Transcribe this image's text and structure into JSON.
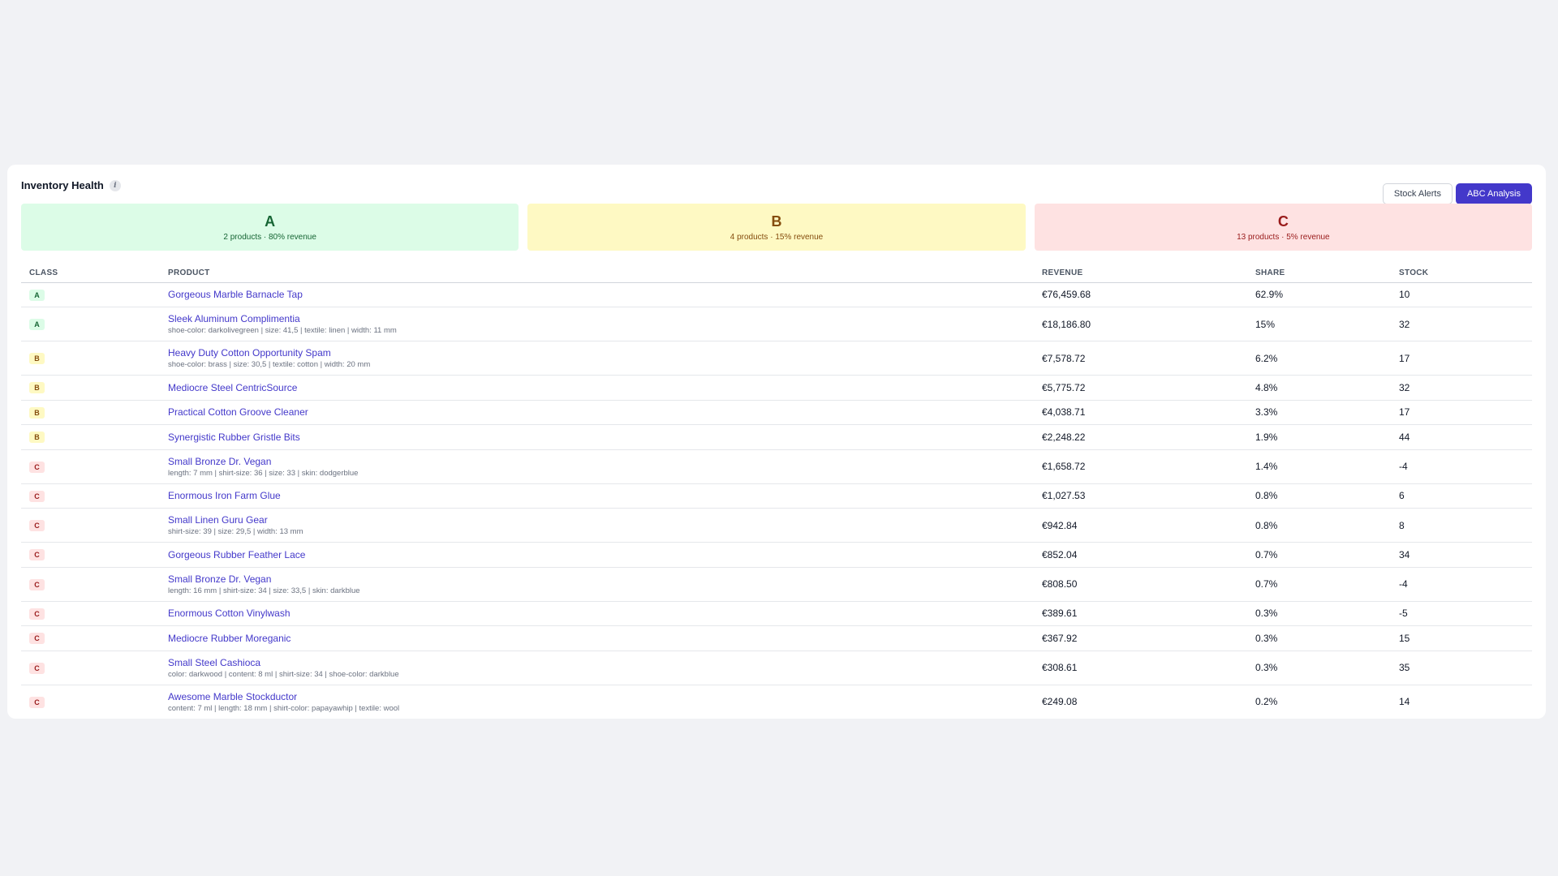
{
  "header": {
    "title": "Inventory Health",
    "info_icon": "info-icon"
  },
  "toggle": {
    "stock_alerts": "Stock Alerts",
    "abc_analysis": "ABC Analysis",
    "active": "ABC Analysis"
  },
  "summary": [
    {
      "letter": "A",
      "desc": "2 products · 80% revenue",
      "color": "#166534",
      "bg": "#dcfce7"
    },
    {
      "letter": "B",
      "desc": "4 products · 15% revenue",
      "color": "#854d0e",
      "bg": "#fef9c3"
    },
    {
      "letter": "C",
      "desc": "13 products · 5% revenue",
      "color": "#991b1b",
      "bg": "#fee2e2"
    }
  ],
  "table": {
    "columns": [
      "CLASS",
      "PRODUCT",
      "REVENUE",
      "SHARE",
      "STOCK"
    ],
    "rows": [
      {
        "class": "A",
        "product": "Gorgeous Marble Barnacle Tap",
        "attrs": "",
        "revenue": "€76,459.68",
        "share": "62.9%",
        "stock": "10"
      },
      {
        "class": "A",
        "product": "Sleek Aluminum Complimentia",
        "attrs": "shoe-color: darkolivegreen | size: 41,5 | textile: linen | width: 11 mm",
        "revenue": "€18,186.80",
        "share": "15%",
        "stock": "32"
      },
      {
        "class": "B",
        "product": "Heavy Duty Cotton Opportunity Spam",
        "attrs": "shoe-color: brass | size: 30,5 | textile: cotton | width: 20 mm",
        "revenue": "€7,578.72",
        "share": "6.2%",
        "stock": "17"
      },
      {
        "class": "B",
        "product": "Mediocre Steel CentricSource",
        "attrs": "",
        "revenue": "€5,775.72",
        "share": "4.8%",
        "stock": "32"
      },
      {
        "class": "B",
        "product": "Practical Cotton Groove Cleaner",
        "attrs": "",
        "revenue": "€4,038.71",
        "share": "3.3%",
        "stock": "17"
      },
      {
        "class": "B",
        "product": "Synergistic Rubber Gristle Bits",
        "attrs": "",
        "revenue": "€2,248.22",
        "share": "1.9%",
        "stock": "44"
      },
      {
        "class": "C",
        "product": "Small Bronze Dr. Vegan",
        "attrs": "length: 7 mm | shirt-size: 36 | size: 33 | skin: dodgerblue",
        "revenue": "€1,658.72",
        "share": "1.4%",
        "stock": "-4"
      },
      {
        "class": "C",
        "product": "Enormous Iron Farm Glue",
        "attrs": "",
        "revenue": "€1,027.53",
        "share": "0.8%",
        "stock": "6"
      },
      {
        "class": "C",
        "product": "Small Linen Guru Gear",
        "attrs": "shirt-size: 39 | size: 29,5 | width: 13 mm",
        "revenue": "€942.84",
        "share": "0.8%",
        "stock": "8"
      },
      {
        "class": "C",
        "product": "Gorgeous Rubber Feather Lace",
        "attrs": "",
        "revenue": "€852.04",
        "share": "0.7%",
        "stock": "34"
      },
      {
        "class": "C",
        "product": "Small Bronze Dr. Vegan",
        "attrs": "length: 16 mm | shirt-size: 34 | size: 33,5 | skin: darkblue",
        "revenue": "€808.50",
        "share": "0.7%",
        "stock": "-4"
      },
      {
        "class": "C",
        "product": "Enormous Cotton Vinylwash",
        "attrs": "",
        "revenue": "€389.61",
        "share": "0.3%",
        "stock": "-5"
      },
      {
        "class": "C",
        "product": "Mediocre Rubber Moreganic",
        "attrs": "",
        "revenue": "€367.92",
        "share": "0.3%",
        "stock": "15"
      },
      {
        "class": "C",
        "product": "Small Steel Cashioca",
        "attrs": "color: darkwood | content: 8 ml | shirt-size: 34 | shoe-color: darkblue",
        "revenue": "€308.61",
        "share": "0.3%",
        "stock": "35"
      },
      {
        "class": "C",
        "product": "Awesome Marble Stockductor",
        "attrs": "content: 7 ml | length: 18 mm | shirt-color: papayawhip | textile: wool",
        "revenue": "€249.08",
        "share": "0.2%",
        "stock": "14"
      }
    ]
  }
}
